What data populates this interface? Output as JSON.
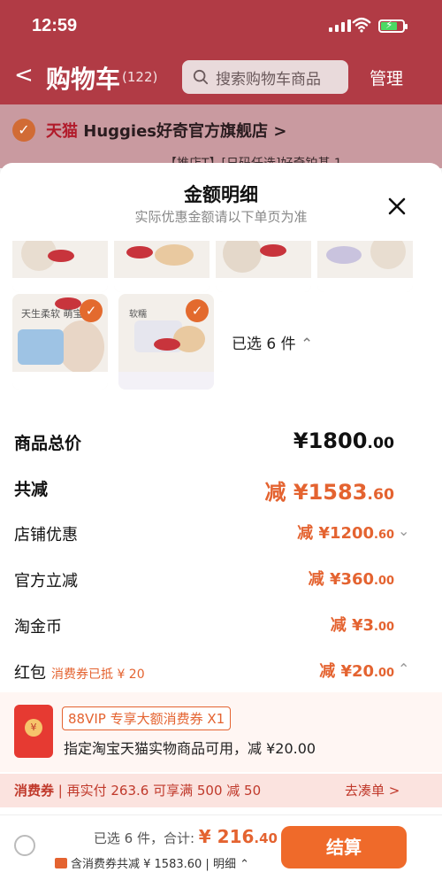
{
  "status": {
    "time": "12:59"
  },
  "nav": {
    "back": "<",
    "title": "购物车",
    "count": "(122)",
    "search_placeholder": "搜索购物车商品",
    "manage": "管理"
  },
  "shop": {
    "tmall": "天猫",
    "name": "Huggies好奇官方旗舰店",
    "chevron": ">",
    "partial_line": "【推店T】[日码任选]好奇铂基  1"
  },
  "sheet": {
    "title": "金额明细",
    "subtitle": "实际优惠金额请以下单页为准",
    "selected": "已选 6 件",
    "thumb_logo": "Huggies",
    "thumb_text1": "天生柔软 萌宝",
    "thumb_text2": "软糯"
  },
  "rows": [
    {
      "label": "商品总价",
      "value_int": "¥1800",
      "value_dec": ".00",
      "style": "total"
    },
    {
      "label": "共减",
      "value_int": "减 ¥1583",
      "value_dec": ".60",
      "style": "reduce"
    },
    {
      "label": "店铺优惠",
      "value_int": "减 ¥1200",
      "value_dec": ".60",
      "style": "item",
      "chev": "⌄"
    },
    {
      "label": "官方立减",
      "value_int": "减 ¥360",
      "value_dec": ".00",
      "style": "item"
    },
    {
      "label": "淘金币",
      "value_int": "减 ¥3",
      "value_dec": ".00",
      "style": "item"
    },
    {
      "label": "红包",
      "tag": "消费券已抵 ¥ 20",
      "value_int": "减 ¥20",
      "value_dec": ".00",
      "style": "item",
      "chev": "⌃"
    }
  ],
  "coupon": {
    "seal": "¥",
    "badge": "88VIP 专享大额消费券 X1",
    "desc": "指定淘宝天猫实物商品可用，减 ¥20.00"
  },
  "coupon_bar": {
    "label": "消费券",
    "text": "| 再实付 263.6 可享满 500 减 50",
    "action": "去凑单 >"
  },
  "checkout": {
    "selected": "已选 6 件，合计:",
    "total_int": "¥ 216",
    "total_dec": ".40",
    "discount": "含消费券共减 ¥ 1583.60 | 明细 ⌃",
    "button": "结算"
  },
  "colors": {
    "accent": "#e46330",
    "header": "#b13b45",
    "button": "#ef6a2a"
  }
}
